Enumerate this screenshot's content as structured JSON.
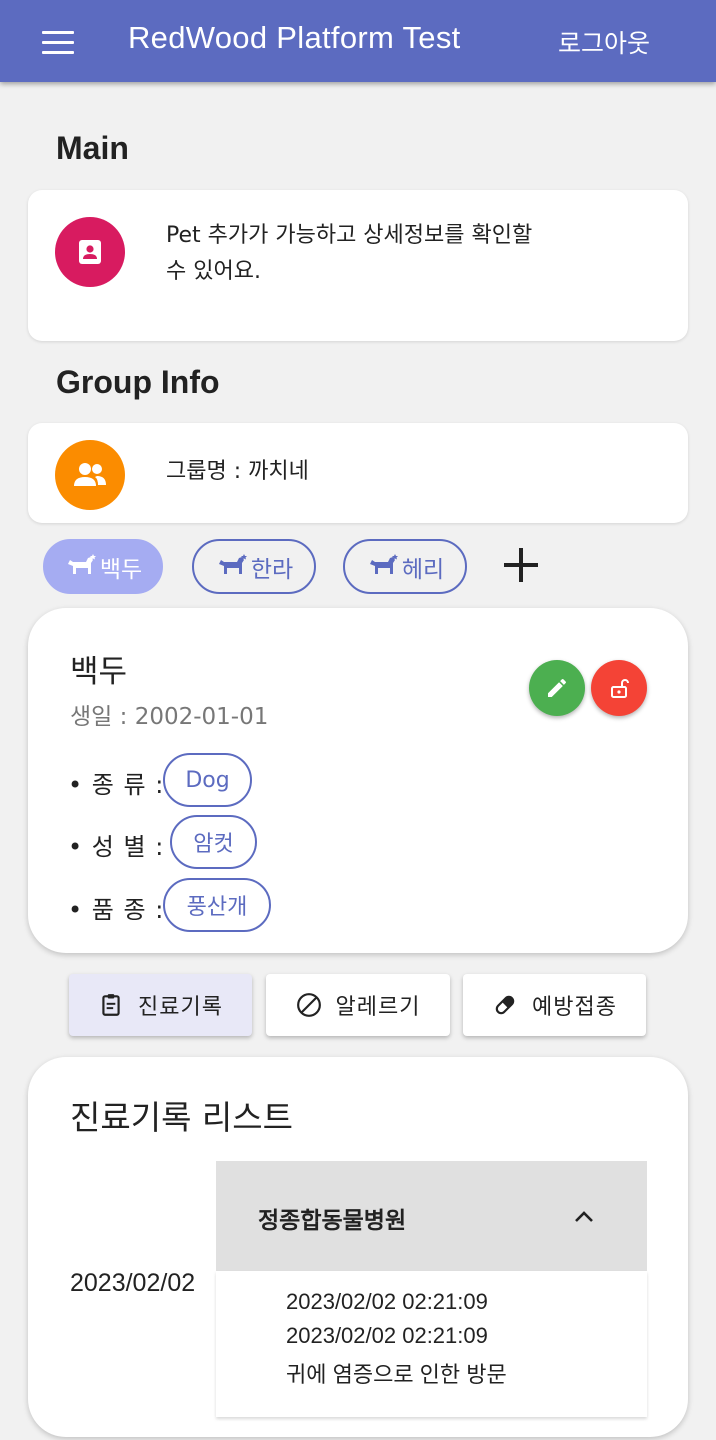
{
  "appbar": {
    "title": "RedWood Platform Test",
    "logout_label": "로그아웃"
  },
  "main": {
    "section_title": "Main",
    "description_line1": "Pet 추가가 가능하고 상세정보를 확인할",
    "description_line2": "수 있어요."
  },
  "group": {
    "section_title": "Group Info",
    "group_name_text": "그룹명 : 까치네"
  },
  "pets": [
    {
      "name": "백두",
      "active": true
    },
    {
      "name": "한라",
      "active": false
    },
    {
      "name": "헤리",
      "active": false
    }
  ],
  "pet_detail": {
    "name": "백두",
    "birth": "생일 : 2002-01-01",
    "species_label": "• 종 류 :",
    "species": "Dog",
    "gender_label": "• 성 별 :",
    "gender": "암컷",
    "breed_label": "• 품 종 :",
    "breed": "풍산개"
  },
  "tabs": [
    {
      "label": "진료기록",
      "icon": "clipboard-icon",
      "active": true
    },
    {
      "label": "알레르기",
      "icon": "block-icon",
      "active": false
    },
    {
      "label": "예방접종",
      "icon": "pill-icon",
      "active": false
    }
  ],
  "records": {
    "title": "진료기록 리스트",
    "items": [
      {
        "date": "2023/02/02",
        "hospital": "정종합동물병원",
        "created": "2023/02/02 02:21:09",
        "updated": "2023/02/02 02:21:09",
        "note": "귀에 염증으로 인한 방문"
      }
    ]
  },
  "colors": {
    "primary": "#5c6bc0",
    "chip_active": "#a5acf2",
    "main_icon": "#d81b60",
    "group_icon": "#fb8c00",
    "edit_fab": "#4caf50",
    "lock_fab": "#f44336"
  }
}
